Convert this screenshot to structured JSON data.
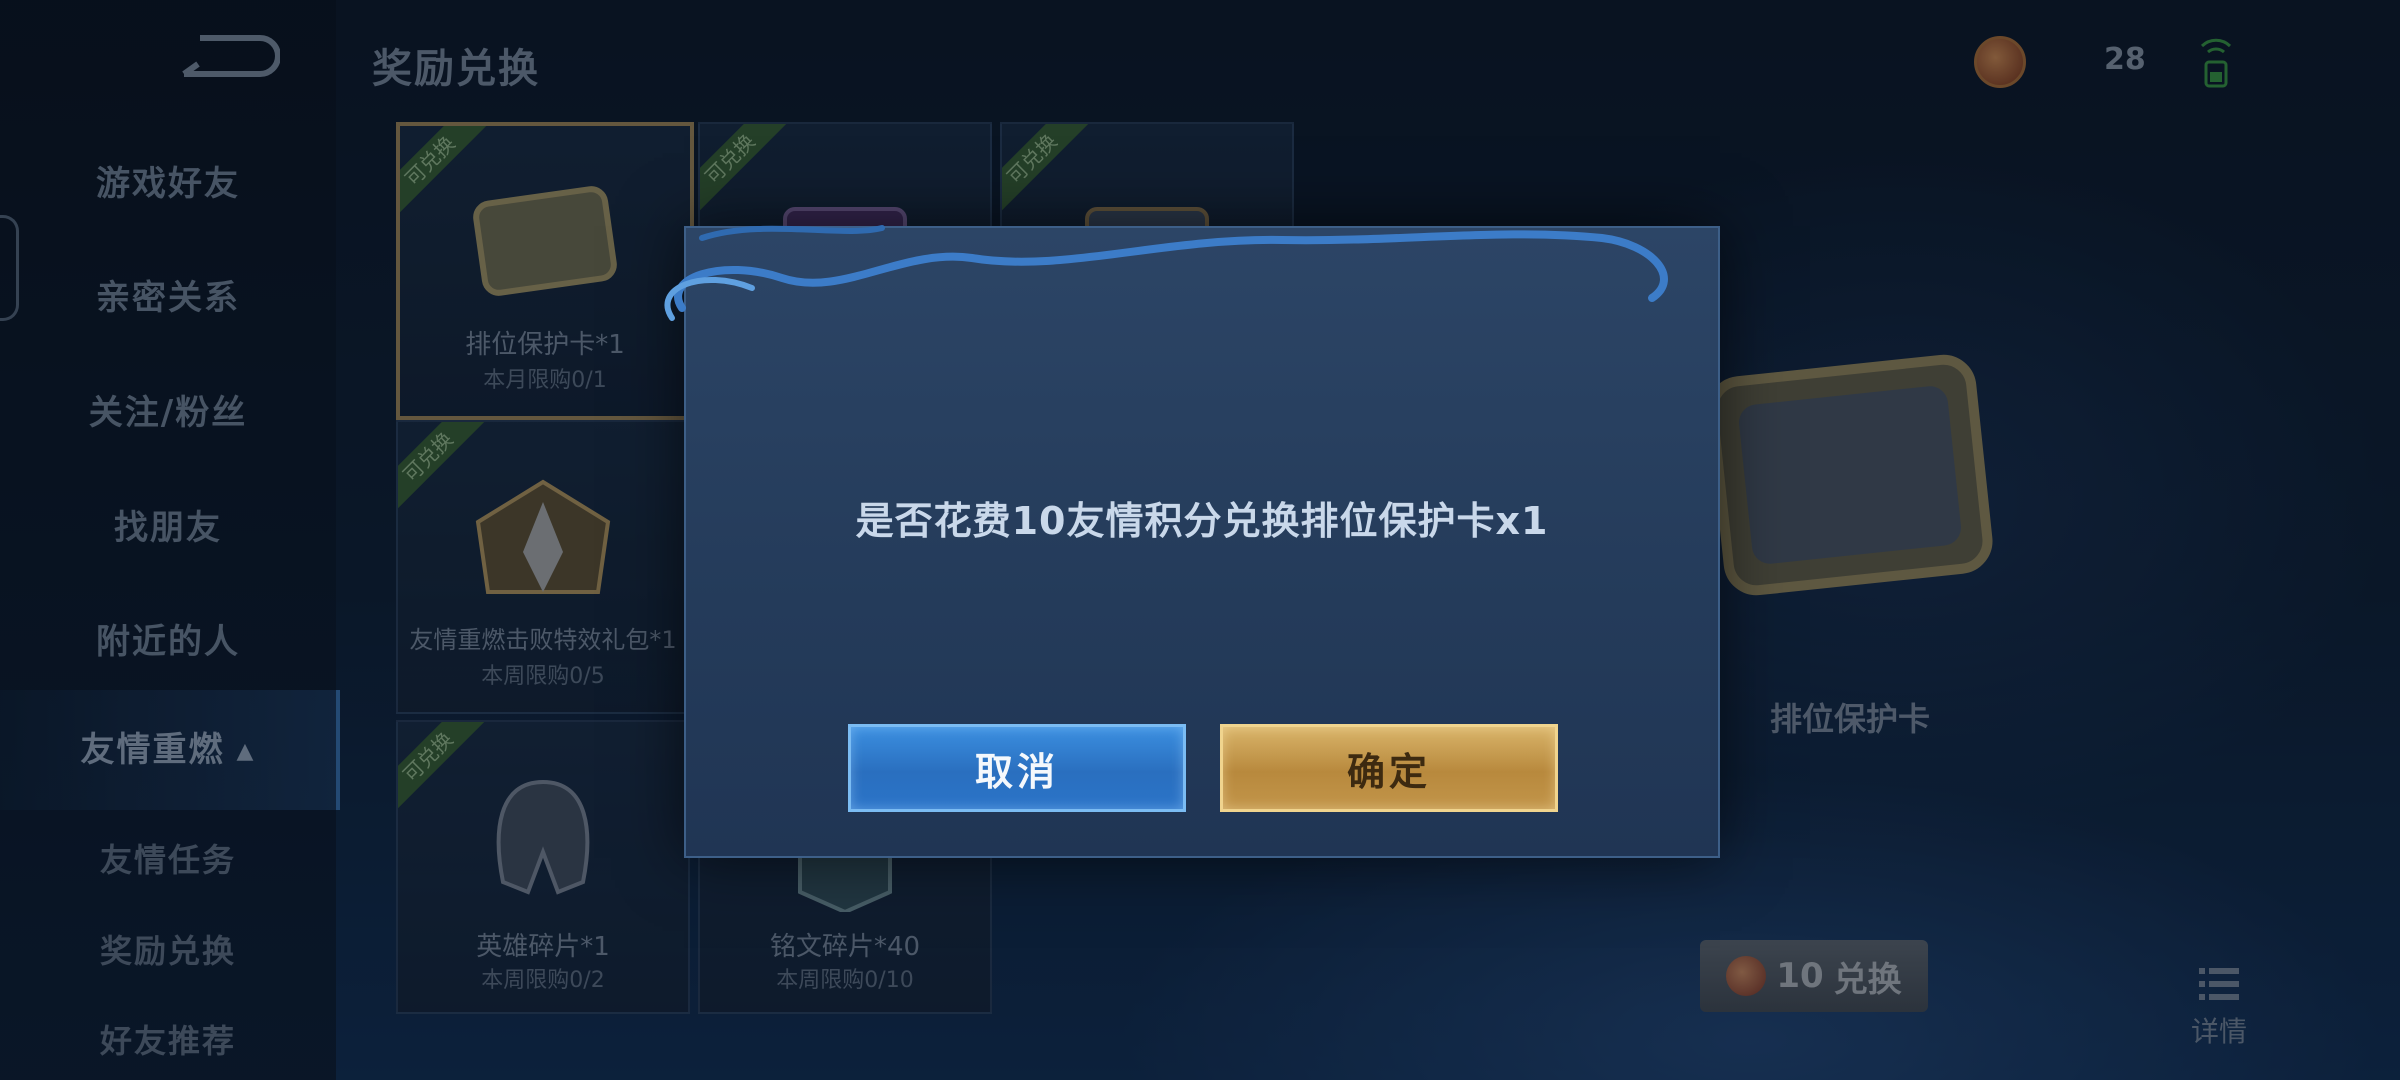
{
  "header": {
    "title": "奖励兑换",
    "coin_count": "28"
  },
  "sidebar": {
    "items": [
      {
        "label": "游戏好友"
      },
      {
        "label": "亲密关系"
      },
      {
        "label": "关注/粉丝"
      },
      {
        "label": "找朋友"
      },
      {
        "label": "附近的人"
      },
      {
        "label": "友情重燃"
      }
    ],
    "sub_items": [
      {
        "label": "友情任务"
      },
      {
        "label": "奖励兑换"
      },
      {
        "label": "好友推荐"
      }
    ]
  },
  "cards": [
    {
      "badge": "可兑换",
      "name": "排位保护卡*1",
      "limit": "本月限购0/1",
      "art_text": "排位保护卡"
    },
    {
      "badge": "可兑换",
      "name": "",
      "limit": ""
    },
    {
      "badge": "可兑换",
      "name": "",
      "limit": ""
    },
    {
      "badge": "可兑换",
      "name": "友情重燃击败特效礼包*1",
      "limit": "本周限购0/5"
    },
    {
      "badge": "可兑换",
      "name": "英雄碎片*1",
      "limit": "本周限购0/2"
    },
    {
      "badge": "",
      "name": "铭文碎片*40",
      "limit": "本周限购0/10"
    }
  ],
  "preview": {
    "name": "排位保护卡",
    "art_text": "排位保护卡",
    "price": "10",
    "exchange_label": "兑换",
    "detail_label": "详情"
  },
  "modal": {
    "message": "是否花费10友情积分兑换排位保护卡x1",
    "cancel_label": "取消",
    "confirm_label": "确定"
  },
  "colors": {
    "accent_blue": "#3b8fe0",
    "accent_gold": "#d9b46a",
    "badge_green": "#3e6a3a"
  }
}
